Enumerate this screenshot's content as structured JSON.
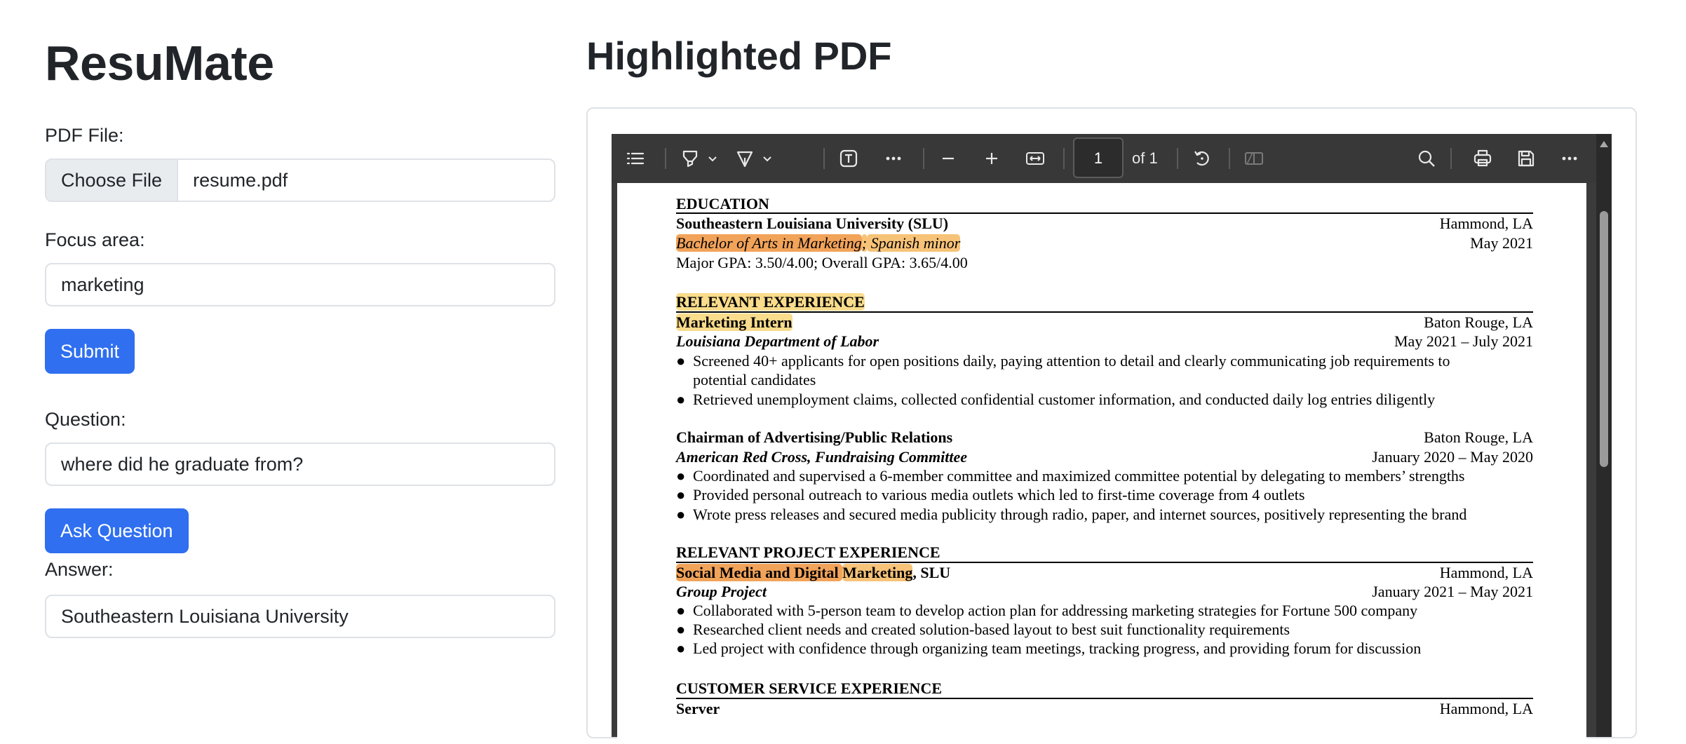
{
  "app": {
    "title": "ResuMate",
    "pdf_label": "PDF File:",
    "choose_file": "Choose File",
    "file_name": "resume.pdf",
    "focus_label": "Focus area:",
    "focus_value": "marketing",
    "submit_label": "Submit",
    "question_label": "Question:",
    "question_value": "where did he graduate from?",
    "ask_label": "Ask Question",
    "answer_label": "Answer:",
    "answer_value": "Southeastern Louisiana University"
  },
  "viewer": {
    "title": "Highlighted PDF",
    "page_number": "1",
    "page_of": "of 1",
    "icons": [
      "list-icon",
      "highlighter-icon",
      "chevron-down-icon",
      "draw-icon",
      "chevron-down-icon",
      "text-icon",
      "more-icon",
      "zoom-out-icon",
      "zoom-in-icon",
      "fit-width-icon",
      "rotate-icon",
      "two-page-icon",
      "search-icon",
      "print-icon",
      "save-icon",
      "more-icon"
    ]
  },
  "resume": {
    "education": {
      "heading": "EDUCATION",
      "school": "Southeastern Louisiana University (SLU)",
      "school_loc": "Hammond, LA",
      "degree_a": "Bachelor of Arts in Marketing",
      "degree_sep": ";",
      "degree_b": " Spanish minor",
      "degree_date": "May 2021",
      "gpa": "Major GPA: 3.50/4.00; Overall GPA: 3.65/4.00"
    },
    "experience": {
      "heading": "RELEVANT EXPERIENCE",
      "job1_title": "Marketing Intern",
      "job1_loc": "Baton Rouge, LA",
      "job1_org": "Louisiana Department of Labor",
      "job1_date": "May 2021 – July 2021",
      "job1_b1a": "Screened 40+ applicants for open positions daily, paying attention to detail and clearly communicating job requirements to",
      "job1_b1b": "potential candidates",
      "job1_b2": "Retrieved unemployment claims, collected confidential customer information, and conducted daily log entries diligently",
      "job2_title": "Chairman of Advertising/Public Relations",
      "job2_loc": "Baton Rouge, LA",
      "job2_org": "American Red Cross, Fundraising Committee",
      "job2_date": "January 2020 – May 2020",
      "job2_b1": "Coordinated and supervised a 6-member committee and maximized committee potential by delegating to members’ strengths",
      "job2_b2": "Provided personal outreach to various media outlets which led to first-time coverage from 4 outlets",
      "job2_b3": "Wrote press releases and secured media publicity through radio, paper, and internet sources, positively representing the brand"
    },
    "projects": {
      "heading": "RELEVANT PROJECT EXPERIENCE",
      "proj_a": "Social Media and Digital ",
      "proj_b": "Marketing",
      "proj_c": ", SLU",
      "proj_loc": "Hammond, LA",
      "proj_type": "Group Project",
      "proj_date": "January 2021 – May 2021",
      "b1": "Collaborated with 5-person team to develop action plan for addressing marketing strategies for Fortune 500 company",
      "b2": "Researched client needs and created solution-based layout to best suit functionality requirements",
      "b3": "Led project with confidence through organizing team meetings, tracking progress, and providing forum for discussion"
    },
    "customer_service": {
      "heading": "CUSTOMER SERVICE EXPERIENCE",
      "job_title": "Server",
      "job_loc": "Hammond, LA"
    },
    "bullet": "●"
  }
}
